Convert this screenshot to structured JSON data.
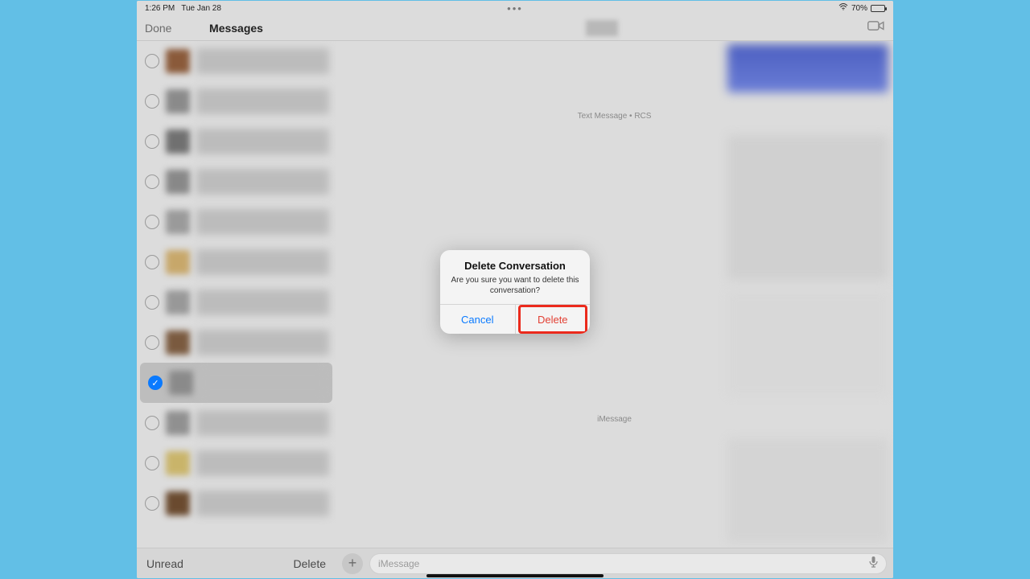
{
  "status": {
    "time": "1:26 PM",
    "date": "Tue Jan 28",
    "battery": "70%"
  },
  "header": {
    "done": "Done",
    "title": "Messages"
  },
  "sidebar": {
    "items": [
      {
        "selected": false,
        "avatar": "#8a5a3a"
      },
      {
        "selected": false,
        "avatar": "#8a8a8a"
      },
      {
        "selected": false,
        "avatar": "#707070"
      },
      {
        "selected": false,
        "avatar": "#888888"
      },
      {
        "selected": false,
        "avatar": "#9a9a9a"
      },
      {
        "selected": false,
        "avatar": "#c7a76a"
      },
      {
        "selected": false,
        "avatar": "#989898"
      },
      {
        "selected": false,
        "avatar": "#7a5a3f"
      },
      {
        "selected": true,
        "avatar": "#8a8a8a"
      },
      {
        "selected": false,
        "avatar": "#909090"
      },
      {
        "selected": false,
        "avatar": "#c9b46a"
      },
      {
        "selected": false,
        "avatar": "#6a4a2f"
      }
    ],
    "unread": "Unread",
    "delete": "Delete"
  },
  "conv": {
    "label1": "Text Message • RCS",
    "label2": "iMessage",
    "compose_placeholder": "iMessage"
  },
  "modal": {
    "title": "Delete Conversation",
    "message": "Are you sure you want to delete this conversation?",
    "cancel": "Cancel",
    "delete": "Delete"
  }
}
